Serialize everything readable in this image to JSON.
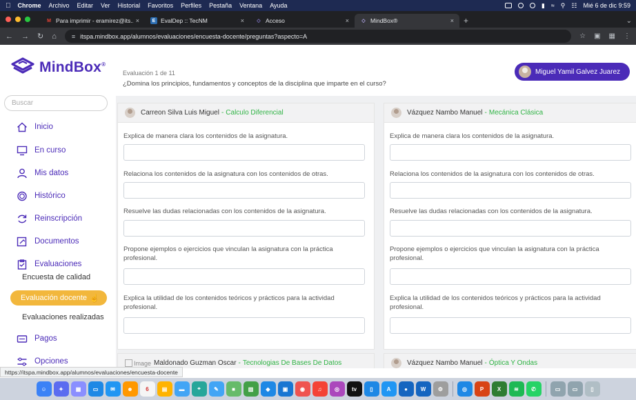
{
  "menubar": {
    "app": "Chrome",
    "items": [
      "Archivo",
      "Editar",
      "Ver",
      "Historial",
      "Favoritos",
      "Perfiles",
      "Pestaña",
      "Ventana",
      "Ayuda"
    ],
    "datetime": "Mié 6 de dic 9:59"
  },
  "tabs": [
    {
      "title": "Para imprimir - eramirez@its...",
      "favicon": "gmail-icon",
      "color": "#ea4335",
      "letter": "M"
    },
    {
      "title": "EvalDep :: TecNM",
      "favicon": "evaldep-icon",
      "color": "#2b6cb0",
      "letter": "E"
    },
    {
      "title": "Acceso",
      "favicon": "mindbox-icon",
      "color": "#4b2bb8",
      "letter": "◇"
    },
    {
      "title": "MindBox®",
      "favicon": "mindbox-icon",
      "color": "#4b2bb8",
      "letter": "◇",
      "active": true
    }
  ],
  "address": {
    "url": "itspa.mindbox.app/alumnos/evaluaciones/encuesta-docente/preguntas?aspecto=A"
  },
  "brand": {
    "name": "MindBox",
    "reg": "®",
    "color": "#4b2bb8"
  },
  "search": {
    "placeholder": "Buscar"
  },
  "nav": [
    {
      "label": "Inicio",
      "icon": "home-icon"
    },
    {
      "label": "En curso",
      "icon": "desktop-icon"
    },
    {
      "label": "Mis datos",
      "icon": "user-icon"
    },
    {
      "label": "Histórico",
      "icon": "history-icon"
    },
    {
      "label": "Reinscripción",
      "icon": "refresh-icon"
    },
    {
      "label": "Documentos",
      "icon": "document-icon"
    },
    {
      "label": "Evaluaciones",
      "icon": "clipboard-icon"
    }
  ],
  "subnav": [
    {
      "label": "Encuesta de calidad"
    },
    {
      "label": "Evaluación docente",
      "active": true
    },
    {
      "label": "Evaluaciones realizadas"
    }
  ],
  "nav2": [
    {
      "label": "Pagos",
      "icon": "payment-icon"
    },
    {
      "label": "Opciones",
      "icon": "options-icon"
    }
  ],
  "header": {
    "counter": "Evaluación 1 de 11",
    "question": "¿Domina los principios, fundamentos y conceptos de la disciplina que imparte en el curso?",
    "user": "Miguel Yamil Galvez Juarez"
  },
  "questions": [
    "Explica de manera clara los contenidos de la asignatura.",
    "Relaciona los contenidos de la asignatura con los contenidos de otras.",
    "Resuelve las dudas relacionadas con los contenidos de la asignatura.",
    "Propone ejemplos o ejercicios que vinculan la asignatura con la práctica profesional.",
    "Explica la utilidad de los contenidos teóricos y prácticos para la actividad profesional."
  ],
  "cards": [
    {
      "teacher": "Carreon Silva Luis Miguel",
      "separator": "-",
      "subject": "Calculo Diferencial"
    },
    {
      "teacher": "Vázquez Nambo Manuel",
      "separator": "-",
      "subject": "Mecánica Clásica"
    },
    {
      "teacher": "Maldonado Guzman Oscar",
      "separator": "-",
      "subject": "Tecnologias De Bases De Datos",
      "broken_image": "Image"
    },
    {
      "teacher": "Vázquez Nambo Manuel",
      "separator": "-",
      "subject": "Óptica Y Ondas"
    }
  ],
  "statusbar": {
    "link": "https://itspa.mindbox.app/alumnos/evaluaciones/encuesta-docente"
  },
  "colors": {
    "accent": "#4b2bb8",
    "active_item": "#f2b73c",
    "subject": "#2fb344"
  }
}
